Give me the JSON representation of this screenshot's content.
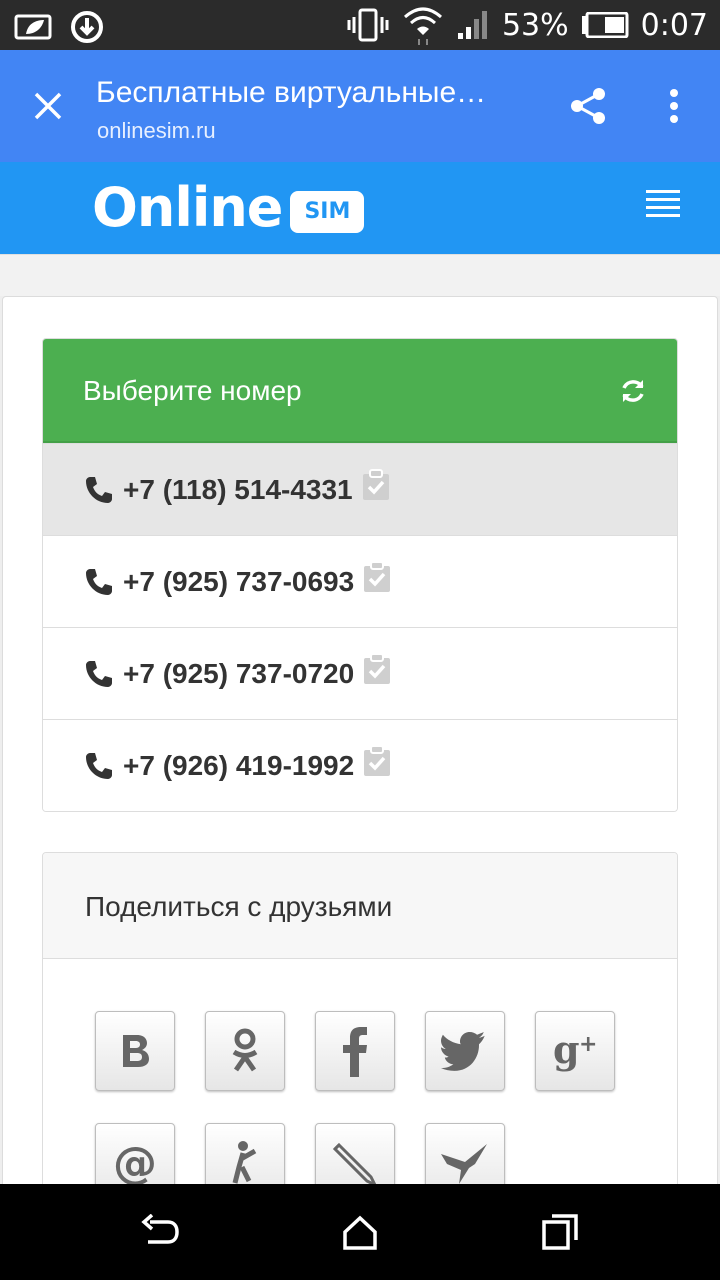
{
  "status_bar": {
    "battery_percent": "53%",
    "time": "0:07"
  },
  "toolbar": {
    "title": "Бесплатные виртуальные…",
    "url": "onlinesim.ru"
  },
  "site": {
    "logo_text": "Online",
    "logo_badge": "SIM"
  },
  "numbers_panel": {
    "title": "Выберите номер",
    "numbers": [
      "+7 (118) 514-4331",
      "+7 (925) 737-0693",
      "+7 (925) 737-0720",
      "+7 (926) 419-1992"
    ]
  },
  "share_panel": {
    "title": "Поделиться с друзьями",
    "buttons": [
      "vkontakte-icon",
      "odnoklassniki-icon",
      "facebook-icon",
      "twitter-icon",
      "google-plus-icon",
      "mail-ru-icon",
      "moi-mir-icon",
      "livejournal-icon",
      "liveinternet-icon"
    ]
  }
}
